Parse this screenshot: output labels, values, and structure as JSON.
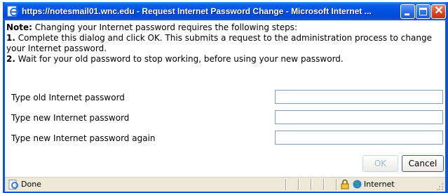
{
  "window": {
    "title": "https://notesmail01.wnc.edu - Request Internet Password Change - Microsoft Internet ..."
  },
  "note": {
    "heading": "Note:",
    "intro": " Changing your Internet password requires the following steps:",
    "step1_num": "1.",
    "step1_text": " Complete this dialog and click OK. This submits a request to the administration process to change your Internet password.",
    "step2_num": "2.",
    "step2_text": " Wait for your old password to stop working, before using your new password."
  },
  "form": {
    "old_password_label": "Type old Internet password",
    "new_password_label": "Type new Internet password",
    "confirm_password_label": "Type new Internet password again",
    "old_password_value": "",
    "new_password_value": "",
    "confirm_password_value": ""
  },
  "buttons": {
    "ok": "OK",
    "cancel": "Cancel"
  },
  "status": {
    "text": "Done",
    "zone": "Internet"
  },
  "icons": {
    "window": "ie-page-icon",
    "status": "ie-page-icon",
    "lock": "padlock-icon",
    "zone": "globe-icon"
  }
}
